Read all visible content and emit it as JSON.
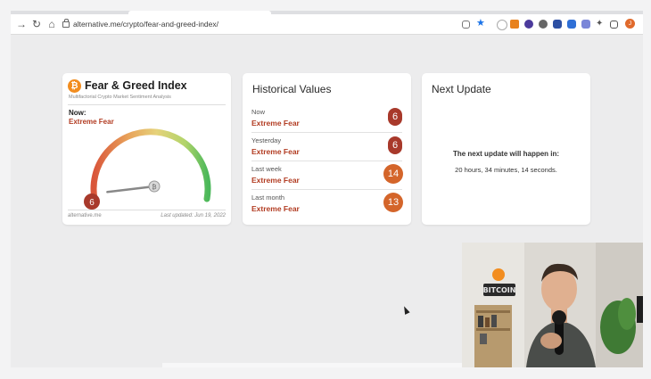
{
  "browser": {
    "url": "alternative.me/crypto/fear-and-greed-index/",
    "profile_initial": "J"
  },
  "fear_greed": {
    "logo_letter": "₿",
    "title": "Fear & Greed Index",
    "subtitle": "Multifactorial Crypto Market Sentiment Analysis",
    "now_label": "Now:",
    "classification": "Extreme Fear",
    "value": "6",
    "gauge_center_symbol": "₿",
    "footer_left": "alternative.me",
    "footer_right": "Last updated: Jun 19, 2022",
    "level": 6
  },
  "historical": {
    "title": "Historical Values",
    "rows": [
      {
        "period": "Now",
        "classification": "Extreme Fear",
        "value": "6",
        "color": "#a8392b"
      },
      {
        "period": "Yesterday",
        "classification": "Extreme Fear",
        "value": "6",
        "color": "#a8392b"
      },
      {
        "period": "Last week",
        "classification": "Extreme Fear",
        "value": "14",
        "color": "#d4652a"
      },
      {
        "period": "Last month",
        "classification": "Extreme Fear",
        "value": "13",
        "color": "#d4652a"
      }
    ]
  },
  "next_update": {
    "title": "Next Update",
    "label": "The next update will happen in:",
    "time": "20 hours, 34 minutes, 14 seconds."
  },
  "webcam": {
    "sign_text": "BITCOIN"
  },
  "colors": {
    "extreme_fear": "#b23c22",
    "badge_dark": "#a8392b",
    "badge_orange": "#d4652a",
    "bitcoin_orange": "#f28d1f"
  }
}
